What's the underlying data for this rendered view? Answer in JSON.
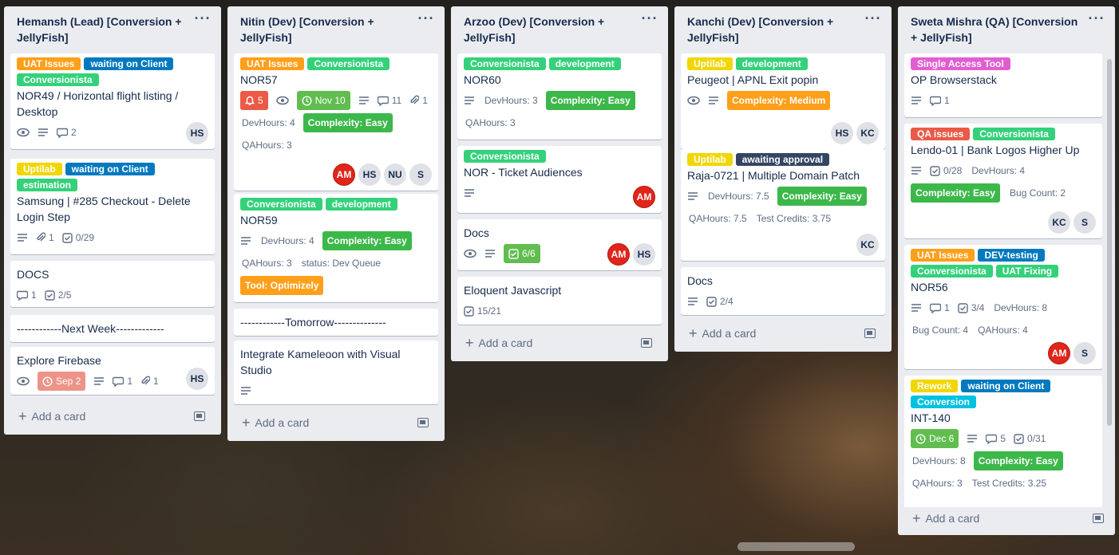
{
  "colors": {
    "orange": "#ff9f1a",
    "blue": "#0079bf",
    "green": "#61bd4f",
    "lime": "#51e898",
    "yellow": "#f2d600",
    "red": "#eb5a46",
    "pink": "#ff78cb",
    "navy": "#344563",
    "sky": "#00c2e0",
    "cf_green": "#3cb84a",
    "cf_orange": "#ff9f1a",
    "due_green": "#61bd4f",
    "due_red": "#ec9488"
  },
  "lists": [
    {
      "title": "Hemansh (Lead) [Conversion + JellyFish]",
      "add": "Add a card",
      "c": [
        {
          "labels": [
            "UAT Issues",
            "waiting on Client",
            "Conversionista"
          ],
          "title": "NOR49 / Horizontal flight listing / Desktop",
          "comments": "2",
          "avatars": [
            "HS"
          ]
        },
        {
          "labels": [
            "Uptilab",
            "waiting on Client",
            "estimation"
          ],
          "title": "Samsung | #285 Checkout - Delete Login Step",
          "attach": "1",
          "check": "0/29"
        },
        {
          "title": "DOCS",
          "comments": "1",
          "check": "2/5"
        },
        {
          "title": "------------Next Week-------------"
        },
        {
          "title": "Explore Firebase",
          "due": "Sep 2",
          "comments": "1",
          "attach": "1",
          "avatars": [
            "HS"
          ]
        }
      ]
    },
    {
      "title": "Nitin (Dev) [Conversion + JellyFish]",
      "add": "Add a card",
      "c": [
        {
          "labels": [
            "UAT Issues",
            "Conversionista"
          ],
          "title": "NOR57",
          "notif": "5",
          "due": "Nov 10",
          "comments": "11",
          "attach": "1",
          "devhours": "DevHours: 4",
          "complexity": "Complexity: Easy",
          "qahours": "QAHours: 3",
          "avatars": [
            "AM",
            "HS",
            "NU",
            "S"
          ]
        },
        {
          "labels": [
            "Conversionista",
            "development"
          ],
          "title": "NOR59",
          "devhours": "DevHours: 4",
          "complexity": "Complexity: Easy",
          "qahours": "QAHours: 3",
          "status": "status: Dev Queue",
          "tool": "Tool: Optimizely"
        },
        {
          "title": "------------Tomorrow--------------"
        },
        {
          "title": "Integrate Kameleoon with Visual Studio"
        }
      ]
    },
    {
      "title": "Arzoo (Dev) [Conversion + JellyFish]",
      "add": "Add a card",
      "c": [
        {
          "labels": [
            "Conversionista",
            "development"
          ],
          "title": "NOR60",
          "devhours": "DevHours: 3",
          "complexity": "Complexity: Easy",
          "qahours": "QAHours: 3"
        },
        {
          "labels": [
            "Conversionista"
          ],
          "title": "NOR - Ticket Audiences",
          "avatars": [
            "AM"
          ]
        },
        {
          "title": "Docs",
          "check": "6/6",
          "avatars": [
            "AM",
            "HS"
          ]
        },
        {
          "title": "Eloquent Javascript",
          "check": "15/21"
        }
      ]
    },
    {
      "title": "Kanchi (Dev) [Conversion + JellyFish]",
      "add": "Add a card",
      "c": [
        {
          "labels": [
            "Uptilab",
            "development"
          ],
          "title": "Peugeot | APNL Exit popin",
          "complexity": "Complexity: Medium",
          "avatars": [
            "HS",
            "KC"
          ]
        },
        {
          "labels": [
            "Uptilab",
            "awaiting approval"
          ],
          "title": "Raja-0721 | Multiple Domain Patch",
          "devhours": "DevHours: 7.5",
          "complexity": "Complexity: Easy",
          "qahours": "QAHours: 7.5",
          "credits": "Test Credits: 3.75",
          "avatars": [
            "KC"
          ]
        },
        {
          "title": "Docs",
          "check": "2/4"
        }
      ]
    },
    {
      "title": "Sweta Mishra (QA) [Conversion + JellyFish]",
      "add": "Add a card",
      "c": [
        {
          "labels": [
            "Single Access Tool"
          ],
          "title": "OP Browserstack",
          "comments": "1"
        },
        {
          "labels": [
            "QA issues",
            "Conversionista"
          ],
          "title": "Lendo-01 | Bank Logos Higher Up",
          "check": "0/28",
          "devhours": "DevHours: 4",
          "complexity": "Complexity: Easy",
          "bugcount": "Bug Count: 2",
          "avatars": [
            "KC",
            "S"
          ]
        },
        {
          "labels": [
            "UAT Issues",
            "DEV-testing",
            "Conversionista",
            "UAT Fixing"
          ],
          "title": "NOR56",
          "comments": "1",
          "check": "3/4",
          "devhours": "DevHours: 8",
          "bugcount": "Bug Count: 4",
          "qahours": "QAHours: 4",
          "avatars": [
            "AM",
            "S"
          ]
        },
        {
          "labels": [
            "Rework",
            "waiting on Client",
            "Conversion"
          ],
          "title": "INT-140",
          "due": "Dec 6",
          "comments": "5",
          "check": "0/31",
          "devhours": "DevHours: 8",
          "complexity": "Complexity: Easy",
          "qahours": "QAHours: 3",
          "credits": "Test Credits: 3.25"
        }
      ]
    }
  ]
}
